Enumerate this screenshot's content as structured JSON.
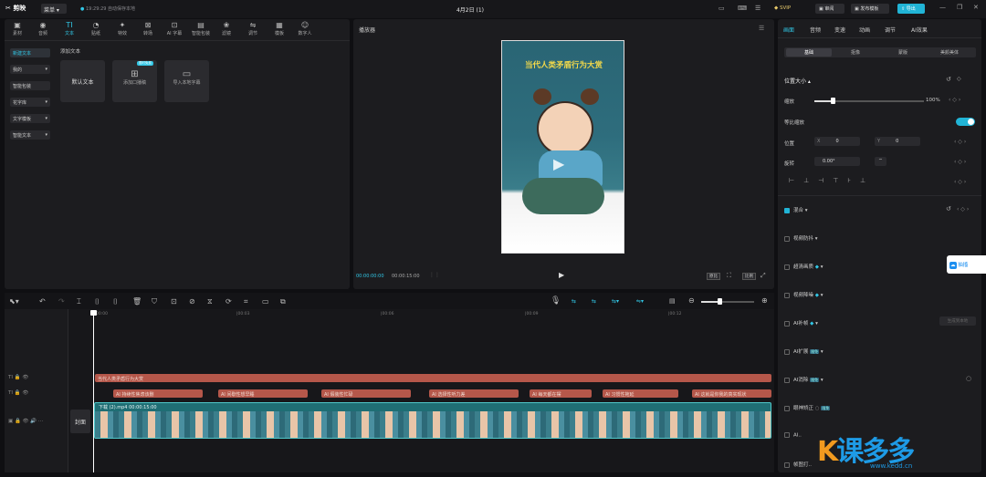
{
  "app": {
    "logo": "剪映",
    "menu": "菜单",
    "autosave": "19:29:29 自动保存本地",
    "project_title": "4月2日 (1)",
    "svip": "SVIP",
    "btn_review": "审阅",
    "btn_publish_template": "发布模板",
    "btn_export": "导出"
  },
  "toolbar": {
    "tabs": [
      "素材",
      "音频",
      "文本",
      "贴纸",
      "特效",
      "转场",
      "AI 字幕",
      "智能包装",
      "滤镜",
      "调节",
      "模板",
      "数字人"
    ]
  },
  "library": {
    "side": [
      "新建文本",
      "我的",
      "智能包装",
      "花字库",
      "文字模板",
      "智能文本"
    ],
    "section": "添加文本",
    "cards": [
      "默认文本",
      "添加口播稿",
      "导入本地字幕"
    ],
    "card_badge": "限时免费"
  },
  "player": {
    "title": "播放器",
    "time_current": "00:00:00:00",
    "time_total": "00:00:15:00",
    "poster_caption": "当代人类矛盾行为大赏",
    "btn_native": "原比",
    "btn_ratio": "比例"
  },
  "right": {
    "tabs": [
      "画面",
      "音频",
      "变速",
      "动画",
      "调节",
      "AI效果"
    ],
    "subtabs": [
      "基础",
      "抠像",
      "蒙版",
      "美颜美体"
    ],
    "position_size": "位置大小",
    "scale_label": "缩放",
    "scale_value": "100%",
    "uniform_scale": "等比缩放",
    "position_label": "位置",
    "x_label": "X",
    "x_value": "0",
    "y_label": "Y",
    "y_value": "0",
    "rotate_label": "旋转",
    "rotate_value": "0.00°",
    "blend": "混合",
    "stabilize": "视频防抖",
    "hd": "超清画质",
    "denoise": "视频降噪",
    "ai_fill": "AI补帧",
    "ai_expand": "AI扩展",
    "ai_eliminate": "AI消除",
    "eye_correct": "眼神矫正",
    "ai_tag": "限免",
    "ai_generate": "生成到本地",
    "more": "AI..",
    "promo": "抽搐",
    "last_item": "帧图打.."
  },
  "timeline": {
    "marks": [
      "00:00",
      "|00:03",
      "|00:06",
      "|00:09",
      "|00:12"
    ],
    "cover": "封面",
    "text_track_title": "当代人类矛盾行为大赏",
    "text_clips": [
      "AI 持续性焦虑该删",
      "AI 间歇性想早睡",
      "AI 假装性忙碌",
      "AI 选择性听力差",
      "AI 每天都在摆",
      "AI 习惯性拖延",
      "AI 这就是你我的真实现状"
    ],
    "video_clip": "下载 (2).mp4  00:00:15:00"
  },
  "watermark": {
    "brand": "课多多",
    "url": "www.kedd.cn"
  },
  "colors": {
    "accent": "#31c7e6",
    "text_clip": "#b5574a",
    "video_clip": "#1f6e74"
  }
}
